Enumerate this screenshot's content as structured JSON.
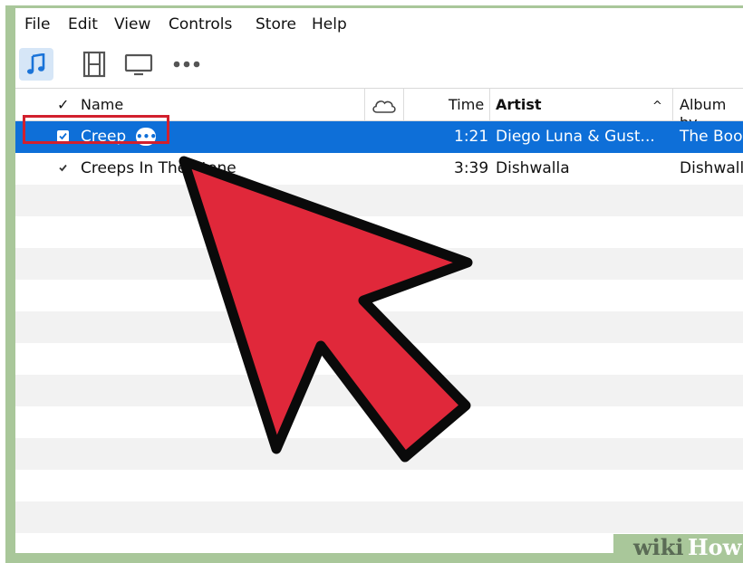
{
  "menu": {
    "file": "File",
    "edit": "Edit",
    "view": "View",
    "controls": "Controls",
    "store": "Store",
    "help": "Help"
  },
  "toolbar": {
    "music_icon": "music-note-icon",
    "movies_icon": "film-icon",
    "tv_icon": "tv-icon",
    "more_icon": "ellipsis-icon"
  },
  "columns": {
    "check": "✓",
    "name": "Name",
    "cloud_icon": "cloud-icon",
    "time": "Time",
    "artist": "Artist",
    "sort_indicator": "^",
    "album": "Album by"
  },
  "rows": [
    {
      "name": "Creep",
      "time": "1:21",
      "artist": "Diego Luna & Gust...",
      "album": "The Boo",
      "checked": true,
      "selected": true
    },
    {
      "name": "Creeps In The Stone",
      "time": "3:39",
      "artist": "Dishwalla",
      "album": "Dishwall",
      "checked": true,
      "selected": false
    }
  ],
  "watermark": {
    "prefix": "wiki",
    "suffix": "How"
  },
  "colors": {
    "selection": "#0e6fd8",
    "highlight_box": "#d2202d",
    "arrow_fill": "#e0283a",
    "frame_green": "#a9c79a"
  }
}
